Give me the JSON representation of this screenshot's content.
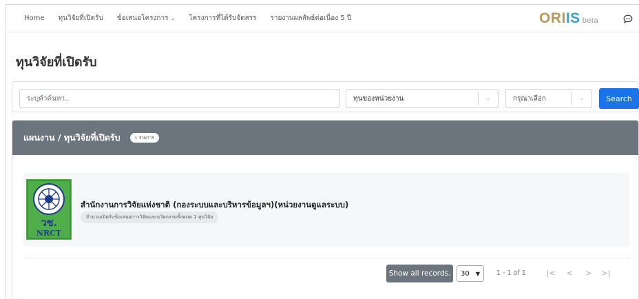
{
  "nav": {
    "items": [
      {
        "label": "Home"
      },
      {
        "label": "ทุนวิจัยที่เปิดรับ"
      },
      {
        "label": "ข้อเสนอโครงการ",
        "has_dropdown": true
      },
      {
        "label": "โครงการที่ได้รับจัดสรร"
      },
      {
        "label": "รายงานผลลัพธ์ต่อเนื่อง 5 ปี"
      }
    ],
    "logo": {
      "text_main": "ORI",
      "text_accent": "IS",
      "suffix": "beta"
    },
    "chat_icon": "chat-bubble-icon"
  },
  "page": {
    "title": "ทุนวิจัยที่เปิดรับ"
  },
  "search": {
    "placeholder": "ระบุคำค้นหา..",
    "department_select": "ทุนของหน่วยงาน",
    "choose_select": "กรุณาเลือก",
    "button_label": "Search",
    "accent_color": "#1a73e8"
  },
  "results": {
    "header_title": "แผนงาน / ทุนวิจัยที่เปิดรับ",
    "count_badge": "1 รายการ",
    "header_color": "#6c757d",
    "items": [
      {
        "org_name": "สำนักงานการวิจัยแห่งชาติ (กองระบบและบริหารข้อมูลฯ)(หน่วยงานดูแลระบบ)",
        "summary": "จำนวนเปิดรับข้อเสนอการวิจัยและนวัตกรรมทั้งหมด 1 ทุนวิจัย",
        "logo_text_top": "วช.",
        "logo_text_bottom": "NRCT"
      }
    ]
  },
  "pagination": {
    "show_all_label": "Show all records.",
    "page_size": "30",
    "range_text": "1 - 1 of 1",
    "first": "|<",
    "prev": "<",
    "next": ">",
    "last": ">|"
  }
}
